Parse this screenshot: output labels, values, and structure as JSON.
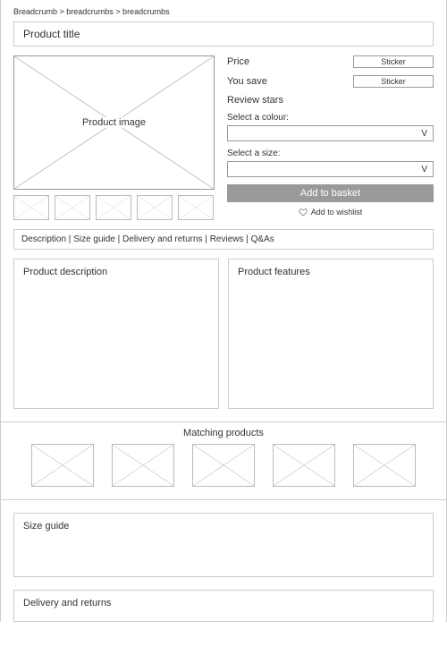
{
  "breadcrumb": "Breadcrumb > breadcrumbs > breadcrumbs",
  "title": "Product title",
  "hero_label": "Product image",
  "price_label": "Price",
  "save_label": "You save",
  "stars_label": "Review stars",
  "sticker1": "Sticker",
  "sticker2": "Sticker",
  "colour_label": "Select a colour:",
  "size_label": "Select a size:",
  "select_arrow": "V",
  "basket_label": "Add to basket",
  "wishlist_label": "Add to wishlist",
  "tabs": {
    "t1": "Description",
    "t2": "Size guide",
    "t3": "Delivery and returns",
    "t4": "Reviews",
    "t5": "Q&As"
  },
  "sep": " | ",
  "desc_heading": "Product description",
  "feat_heading": "Product features",
  "matching_heading": "Matching products",
  "sizeguide_heading": "Size guide",
  "delivery_heading": "Delivery and returns"
}
